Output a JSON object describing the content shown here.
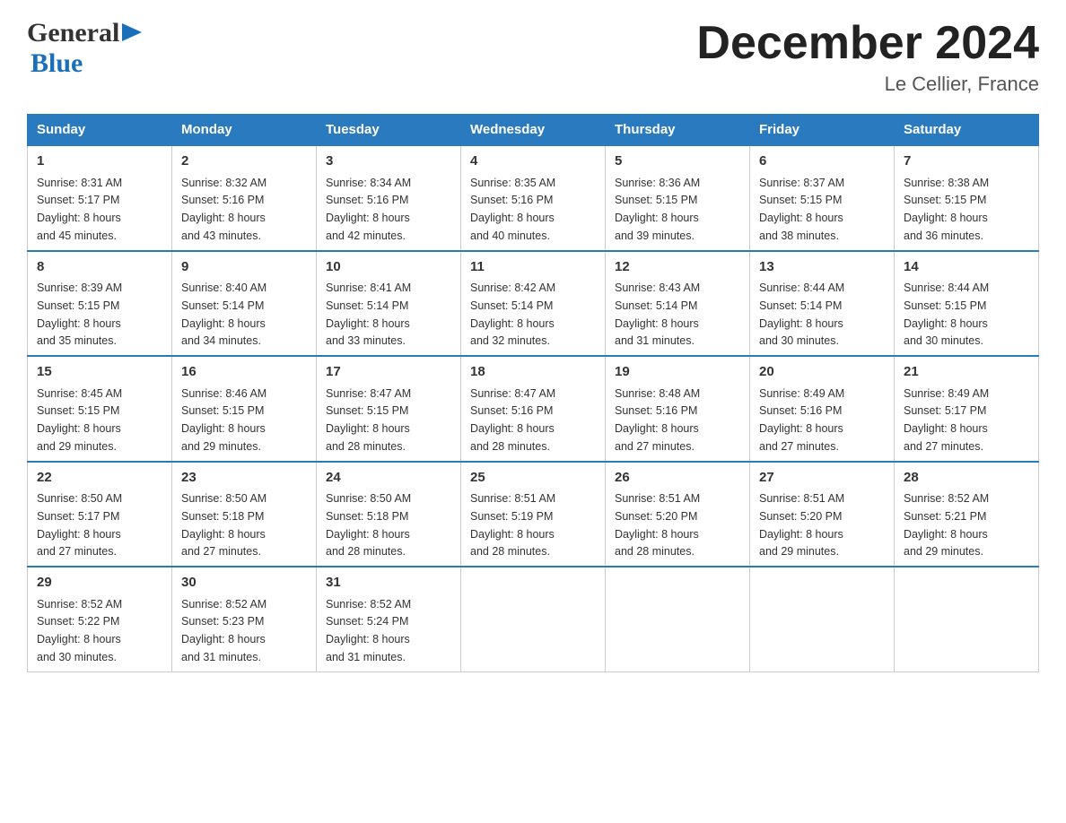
{
  "header": {
    "title": "December 2024",
    "subtitle": "Le Cellier, France"
  },
  "logo": {
    "line1": "General",
    "line2": "Blue"
  },
  "days_of_week": [
    "Sunday",
    "Monday",
    "Tuesday",
    "Wednesday",
    "Thursday",
    "Friday",
    "Saturday"
  ],
  "weeks": [
    [
      {
        "day": "1",
        "sunrise": "8:31 AM",
        "sunset": "5:17 PM",
        "daylight": "8 hours and 45 minutes."
      },
      {
        "day": "2",
        "sunrise": "8:32 AM",
        "sunset": "5:16 PM",
        "daylight": "8 hours and 43 minutes."
      },
      {
        "day": "3",
        "sunrise": "8:34 AM",
        "sunset": "5:16 PM",
        "daylight": "8 hours and 42 minutes."
      },
      {
        "day": "4",
        "sunrise": "8:35 AM",
        "sunset": "5:16 PM",
        "daylight": "8 hours and 40 minutes."
      },
      {
        "day": "5",
        "sunrise": "8:36 AM",
        "sunset": "5:15 PM",
        "daylight": "8 hours and 39 minutes."
      },
      {
        "day": "6",
        "sunrise": "8:37 AM",
        "sunset": "5:15 PM",
        "daylight": "8 hours and 38 minutes."
      },
      {
        "day": "7",
        "sunrise": "8:38 AM",
        "sunset": "5:15 PM",
        "daylight": "8 hours and 36 minutes."
      }
    ],
    [
      {
        "day": "8",
        "sunrise": "8:39 AM",
        "sunset": "5:15 PM",
        "daylight": "8 hours and 35 minutes."
      },
      {
        "day": "9",
        "sunrise": "8:40 AM",
        "sunset": "5:14 PM",
        "daylight": "8 hours and 34 minutes."
      },
      {
        "day": "10",
        "sunrise": "8:41 AM",
        "sunset": "5:14 PM",
        "daylight": "8 hours and 33 minutes."
      },
      {
        "day": "11",
        "sunrise": "8:42 AM",
        "sunset": "5:14 PM",
        "daylight": "8 hours and 32 minutes."
      },
      {
        "day": "12",
        "sunrise": "8:43 AM",
        "sunset": "5:14 PM",
        "daylight": "8 hours and 31 minutes."
      },
      {
        "day": "13",
        "sunrise": "8:44 AM",
        "sunset": "5:14 PM",
        "daylight": "8 hours and 30 minutes."
      },
      {
        "day": "14",
        "sunrise": "8:44 AM",
        "sunset": "5:15 PM",
        "daylight": "8 hours and 30 minutes."
      }
    ],
    [
      {
        "day": "15",
        "sunrise": "8:45 AM",
        "sunset": "5:15 PM",
        "daylight": "8 hours and 29 minutes."
      },
      {
        "day": "16",
        "sunrise": "8:46 AM",
        "sunset": "5:15 PM",
        "daylight": "8 hours and 29 minutes."
      },
      {
        "day": "17",
        "sunrise": "8:47 AM",
        "sunset": "5:15 PM",
        "daylight": "8 hours and 28 minutes."
      },
      {
        "day": "18",
        "sunrise": "8:47 AM",
        "sunset": "5:16 PM",
        "daylight": "8 hours and 28 minutes."
      },
      {
        "day": "19",
        "sunrise": "8:48 AM",
        "sunset": "5:16 PM",
        "daylight": "8 hours and 27 minutes."
      },
      {
        "day": "20",
        "sunrise": "8:49 AM",
        "sunset": "5:16 PM",
        "daylight": "8 hours and 27 minutes."
      },
      {
        "day": "21",
        "sunrise": "8:49 AM",
        "sunset": "5:17 PM",
        "daylight": "8 hours and 27 minutes."
      }
    ],
    [
      {
        "day": "22",
        "sunrise": "8:50 AM",
        "sunset": "5:17 PM",
        "daylight": "8 hours and 27 minutes."
      },
      {
        "day": "23",
        "sunrise": "8:50 AM",
        "sunset": "5:18 PM",
        "daylight": "8 hours and 27 minutes."
      },
      {
        "day": "24",
        "sunrise": "8:50 AM",
        "sunset": "5:18 PM",
        "daylight": "8 hours and 28 minutes."
      },
      {
        "day": "25",
        "sunrise": "8:51 AM",
        "sunset": "5:19 PM",
        "daylight": "8 hours and 28 minutes."
      },
      {
        "day": "26",
        "sunrise": "8:51 AM",
        "sunset": "5:20 PM",
        "daylight": "8 hours and 28 minutes."
      },
      {
        "day": "27",
        "sunrise": "8:51 AM",
        "sunset": "5:20 PM",
        "daylight": "8 hours and 29 minutes."
      },
      {
        "day": "28",
        "sunrise": "8:52 AM",
        "sunset": "5:21 PM",
        "daylight": "8 hours and 29 minutes."
      }
    ],
    [
      {
        "day": "29",
        "sunrise": "8:52 AM",
        "sunset": "5:22 PM",
        "daylight": "8 hours and 30 minutes."
      },
      {
        "day": "30",
        "sunrise": "8:52 AM",
        "sunset": "5:23 PM",
        "daylight": "8 hours and 31 minutes."
      },
      {
        "day": "31",
        "sunrise": "8:52 AM",
        "sunset": "5:24 PM",
        "daylight": "8 hours and 31 minutes."
      },
      null,
      null,
      null,
      null
    ]
  ],
  "labels": {
    "sunrise": "Sunrise:",
    "sunset": "Sunset:",
    "daylight": "Daylight:"
  }
}
